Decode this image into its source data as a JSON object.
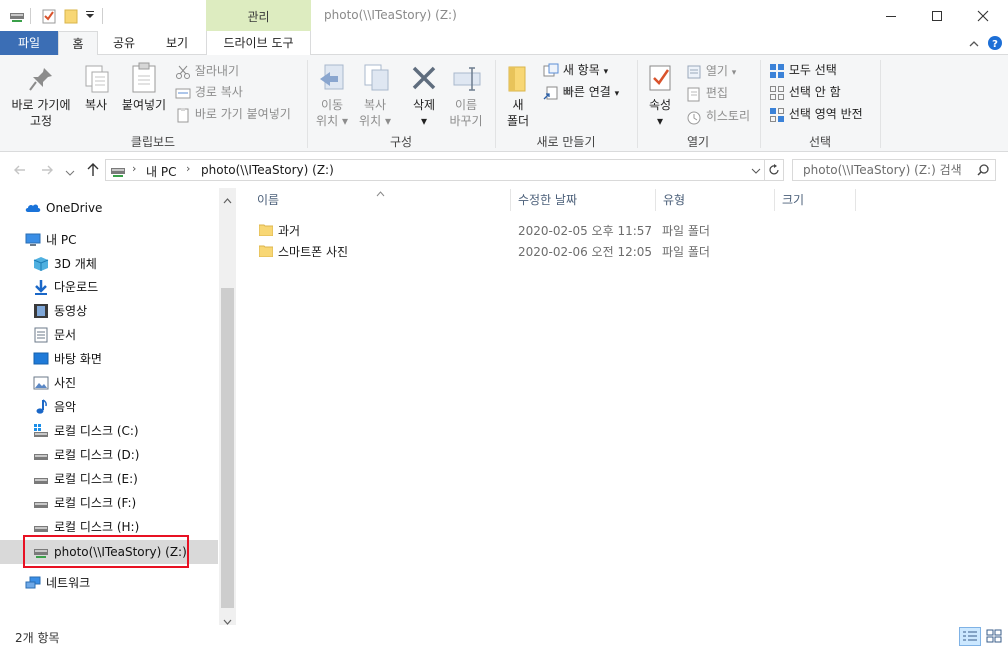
{
  "window": {
    "title": "photo(\\\\ITeaStory) (Z:)",
    "contextual_tab_group": "관리"
  },
  "ribbon_tabs": {
    "file": "파일",
    "home": "홈",
    "share": "공유",
    "view": "보기",
    "drive_tools": "드라이브 도구"
  },
  "ribbon": {
    "clipboard": {
      "label": "클립보드",
      "pin_line1": "바로 가기에",
      "pin_line2": "고정",
      "copy": "복사",
      "paste": "붙여넣기",
      "cut": "잘라내기",
      "copy_path": "경로 복사",
      "paste_shortcut": "바로 가기 붙여넣기"
    },
    "organize": {
      "label": "구성",
      "move_line1": "이동",
      "move_line2": "위치",
      "copy_line1": "복사",
      "copy_line2": "위치",
      "delete": "삭제",
      "rename_line1": "이름",
      "rename_line2": "바꾸기"
    },
    "new": {
      "label": "새로 만들기",
      "new_folder_line1": "새",
      "new_folder_line2": "폴더",
      "new_item": "새 항목",
      "easy_access": "빠른 연결"
    },
    "open": {
      "label": "열기",
      "properties": "속성",
      "open": "열기",
      "edit": "편집",
      "history": "히스토리"
    },
    "select": {
      "label": "선택",
      "select_all": "모두 선택",
      "select_none": "선택 안 함",
      "invert": "선택 영역 반전"
    }
  },
  "address": {
    "crumb1": "내 PC",
    "crumb2": "photo(\\\\ITeaStory) (Z:)",
    "search_placeholder": "photo(\\\\ITeaStory) (Z:) 검색"
  },
  "nav": {
    "onedrive": "OneDrive",
    "this_pc": "내 PC",
    "objects3d": "3D 개체",
    "downloads": "다운로드",
    "videos": "동영상",
    "documents": "문서",
    "desktop": "바탕 화면",
    "pictures": "사진",
    "music": "음악",
    "drive_c": "로컬 디스크 (C:)",
    "drive_d": "로컬 디스크 (D:)",
    "drive_e": "로컬 디스크 (E:)",
    "drive_f": "로컬 디스크 (F:)",
    "drive_h": "로컬 디스크 (H:)",
    "drive_z": "photo(\\\\ITeaStory) (Z:)",
    "network": "네트워크"
  },
  "columns": {
    "name": "이름",
    "modified": "수정한 날짜",
    "type": "유형",
    "size": "크기"
  },
  "files": [
    {
      "name": "과거",
      "modified": "2020-02-05 오후 11:57",
      "type": "파일 폴더"
    },
    {
      "name": "스마트폰 사진",
      "modified": "2020-02-06 오전 12:05",
      "type": "파일 폴더"
    }
  ],
  "status": {
    "count": "2개 항목"
  },
  "colors": {
    "file_tab": "#3b6eb5",
    "contextual_tab": "#ddecc0",
    "selection": "#cce8ff",
    "highlight_box": "#e81123",
    "folder": "#f8d775"
  }
}
